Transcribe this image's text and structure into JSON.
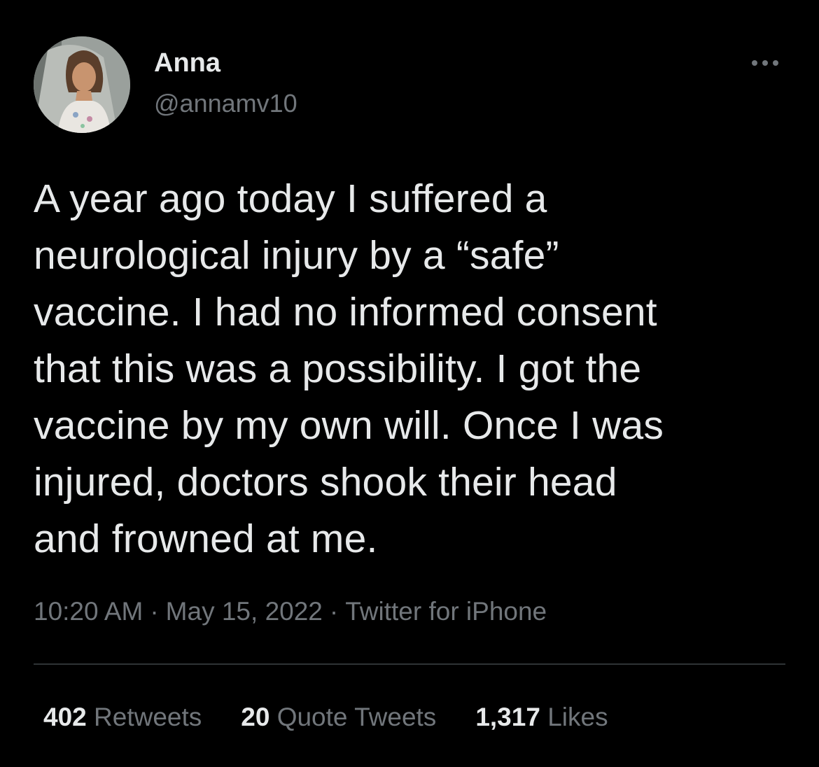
{
  "user": {
    "display_name": "Anna",
    "handle": "@annamv10"
  },
  "icons": {
    "more": "more-horizontal-icon",
    "avatar": "profile-photo"
  },
  "tweet": {
    "lines": [
      "A year ago today I suffered a",
      "neurological injury by a “safe”",
      "vaccine. I had no informed consent",
      "that this was a possibility. I got the",
      "vaccine by my own will. Once I was",
      "injured, doctors shook their head",
      "and frowned at me."
    ]
  },
  "meta": {
    "time": "10:20 AM",
    "separator": "·",
    "date": "May 15, 2022",
    "source": "Twitter for iPhone"
  },
  "stats": {
    "retweets": {
      "count": "402",
      "label": "Retweets"
    },
    "quote_tweets": {
      "count": "20",
      "label": "Quote Tweets"
    },
    "likes": {
      "count": "1,317",
      "label": "Likes"
    }
  },
  "colors": {
    "background": "#000000",
    "primary_text": "#e7e9ea",
    "secondary_text": "#71767b",
    "divider": "#2f3336"
  }
}
